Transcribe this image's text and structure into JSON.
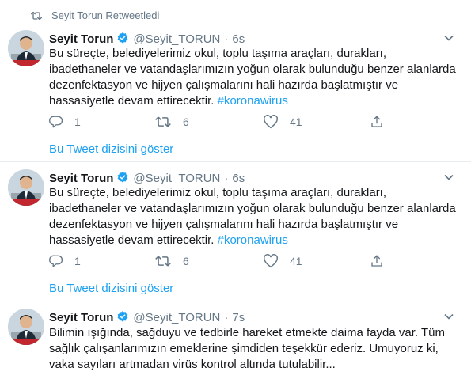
{
  "retweet_label": "Seyit Torun Retweetledi",
  "thread_link": "Bu Tweet dizisini göster",
  "tweets": [
    {
      "name": "Seyit Torun",
      "handle": "@Seyit_TORUN",
      "dot": "·",
      "time": "6s",
      "text": "Bu süreçte, belediyelerimiz okul, toplu taşıma araçları, durakları, ibadethaneler ve vatandaşlarımızın yoğun olarak bulunduğu benzer alanlarda dezenfektasyon ve hijyen çalışmalarını hali hazırda başlatmıştır ve hassasiyetle devam ettirecektir.",
      "hashtag": "#koronawirus",
      "replies": "1",
      "retweets": "6",
      "likes": "41"
    },
    {
      "name": "Seyit Torun",
      "handle": "@Seyit_TORUN",
      "dot": "·",
      "time": "6s",
      "text": "Bu süreçte, belediyelerimiz okul, toplu taşıma araçları, durakları, ibadethaneler ve vatandaşlarımızın yoğun olarak bulunduğu benzer alanlarda dezenfektasyon ve hijyen çalışmalarını hali hazırda başlatmıştır ve hassasiyetle devam ettirecektir.",
      "hashtag": "#koronawirus",
      "replies": "1",
      "retweets": "6",
      "likes": "41"
    },
    {
      "name": "Seyit Torun",
      "handle": "@Seyit_TORUN",
      "dot": "·",
      "time": "7s",
      "text": "Bilimin ışığında, sağduyu ve tedbirle hareket etmekte daima fayda var. Tüm sağlık çalışanlarımızın emeklerine şimdiden teşekkür ederiz. Umuyoruz ki, vaka sayıları artmadan virüs kontrol altında tutulabilir..."
    }
  ],
  "colors": {
    "accent": "#1da1f2",
    "muted": "#657786",
    "text": "#14171a",
    "divider": "#e6ecf0"
  },
  "icons": [
    "retweet-icon",
    "verified-badge-icon",
    "chevron-down-icon",
    "reply-icon",
    "like-icon",
    "share-icon",
    "avatar-photo"
  ]
}
